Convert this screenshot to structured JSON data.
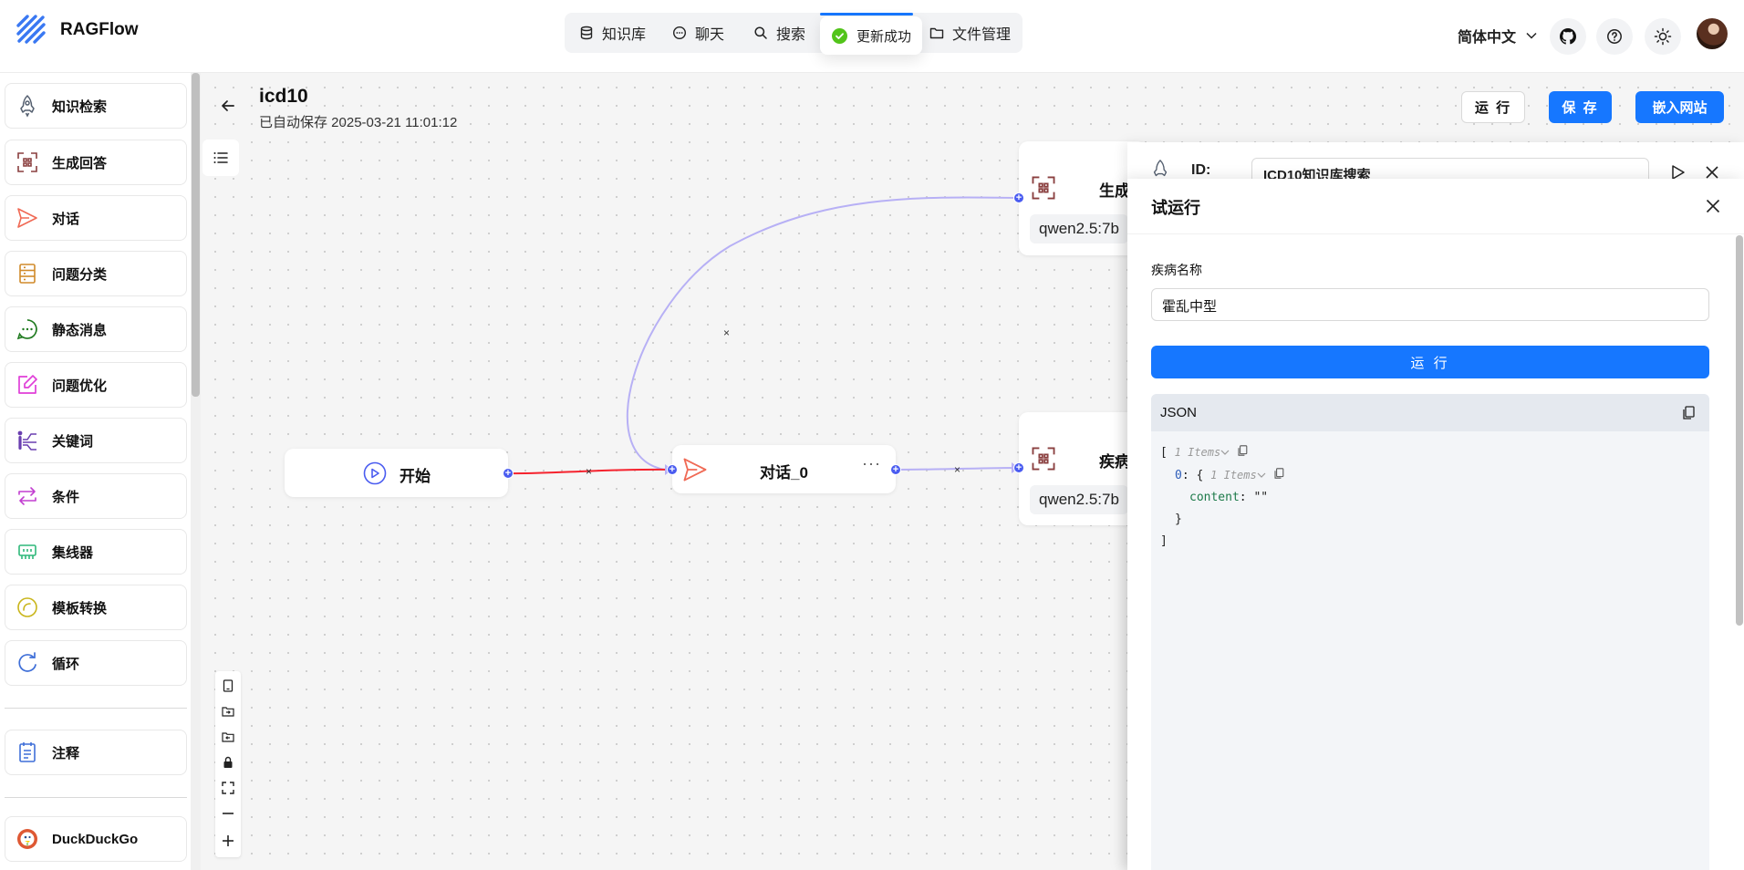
{
  "app": {
    "name": "RAGFlow"
  },
  "nav": {
    "items": [
      {
        "label": "知识库",
        "icon": "database-icon"
      },
      {
        "label": "聊天",
        "icon": "chat-icon"
      },
      {
        "label": "搜索",
        "icon": "search-icon"
      },
      {
        "label": "文件管理",
        "icon": "folder-icon"
      }
    ]
  },
  "toast": {
    "text": "更新成功",
    "status_color": "#52c41a"
  },
  "header_right": {
    "language": "简体中文"
  },
  "sidebar": {
    "items": [
      {
        "label": "知识检索",
        "icon": "rocket-icon"
      },
      {
        "label": "生成回答",
        "icon": "generate-icon"
      },
      {
        "label": "对话",
        "icon": "send-icon"
      },
      {
        "label": "问题分类",
        "icon": "categorize-icon"
      },
      {
        "label": "静态消息",
        "icon": "message-icon"
      },
      {
        "label": "问题优化",
        "icon": "edit-icon"
      },
      {
        "label": "关键词",
        "icon": "keyword-icon"
      },
      {
        "label": "条件",
        "icon": "switch-icon"
      },
      {
        "label": "集线器",
        "icon": "hub-icon"
      },
      {
        "label": "模板转换",
        "icon": "template-icon"
      },
      {
        "label": "循环",
        "icon": "loop-icon"
      }
    ],
    "note": {
      "label": "注释",
      "icon": "note-icon"
    },
    "tool": {
      "label": "DuckDuckGo",
      "icon": "duckduckgo-icon"
    }
  },
  "flow": {
    "title": "icd10",
    "autosave": "已自动保存 2025-03-21 11:01:12",
    "buttons": {
      "run": "运 行",
      "save": "保 存",
      "embed": "嵌入网站"
    },
    "nodes": {
      "start": "开始",
      "dialog": "对话_0",
      "dialog_menu": "···",
      "generate_partial": "生成",
      "disease_partial": "疾病",
      "model_partial": "qwen2.5:7b"
    },
    "edge_delete": "×"
  },
  "retrieval_panel": {
    "id_label": "ID:",
    "id_value": "ICD10知识库搜索"
  },
  "test_run": {
    "title": "试运行",
    "field_label": "疾病名称",
    "field_value": "霍乱中型",
    "run_button": "运 行",
    "json_title": "JSON",
    "json": {
      "open_bracket": "[",
      "items_meta": "1 Items",
      "index": "0",
      "content_key": "content",
      "content_value": "\"\"",
      "close_brace": "}",
      "close_bracket": "]"
    }
  },
  "colors": {
    "accent": "#1677ff",
    "handle": "#4a5cf0",
    "active_edge": "#f5222d",
    "edge": "#b7b0f5"
  }
}
